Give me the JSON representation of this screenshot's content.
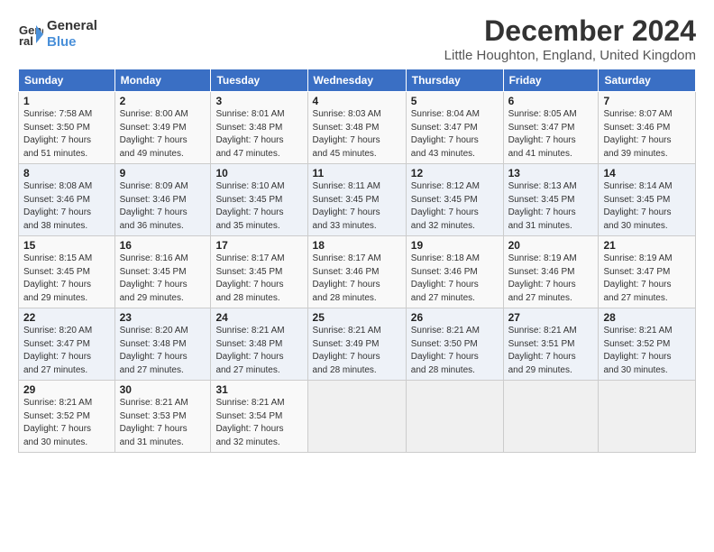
{
  "logo": {
    "line1": "General",
    "line2": "Blue"
  },
  "title": "December 2024",
  "subtitle": "Little Houghton, England, United Kingdom",
  "days_of_week": [
    "Sunday",
    "Monday",
    "Tuesday",
    "Wednesday",
    "Thursday",
    "Friday",
    "Saturday"
  ],
  "weeks": [
    [
      {
        "day": "1",
        "info": "Sunrise: 7:58 AM\nSunset: 3:50 PM\nDaylight: 7 hours\nand 51 minutes."
      },
      {
        "day": "2",
        "info": "Sunrise: 8:00 AM\nSunset: 3:49 PM\nDaylight: 7 hours\nand 49 minutes."
      },
      {
        "day": "3",
        "info": "Sunrise: 8:01 AM\nSunset: 3:48 PM\nDaylight: 7 hours\nand 47 minutes."
      },
      {
        "day": "4",
        "info": "Sunrise: 8:03 AM\nSunset: 3:48 PM\nDaylight: 7 hours\nand 45 minutes."
      },
      {
        "day": "5",
        "info": "Sunrise: 8:04 AM\nSunset: 3:47 PM\nDaylight: 7 hours\nand 43 minutes."
      },
      {
        "day": "6",
        "info": "Sunrise: 8:05 AM\nSunset: 3:47 PM\nDaylight: 7 hours\nand 41 minutes."
      },
      {
        "day": "7",
        "info": "Sunrise: 8:07 AM\nSunset: 3:46 PM\nDaylight: 7 hours\nand 39 minutes."
      }
    ],
    [
      {
        "day": "8",
        "info": "Sunrise: 8:08 AM\nSunset: 3:46 PM\nDaylight: 7 hours\nand 38 minutes."
      },
      {
        "day": "9",
        "info": "Sunrise: 8:09 AM\nSunset: 3:46 PM\nDaylight: 7 hours\nand 36 minutes."
      },
      {
        "day": "10",
        "info": "Sunrise: 8:10 AM\nSunset: 3:45 PM\nDaylight: 7 hours\nand 35 minutes."
      },
      {
        "day": "11",
        "info": "Sunrise: 8:11 AM\nSunset: 3:45 PM\nDaylight: 7 hours\nand 33 minutes."
      },
      {
        "day": "12",
        "info": "Sunrise: 8:12 AM\nSunset: 3:45 PM\nDaylight: 7 hours\nand 32 minutes."
      },
      {
        "day": "13",
        "info": "Sunrise: 8:13 AM\nSunset: 3:45 PM\nDaylight: 7 hours\nand 31 minutes."
      },
      {
        "day": "14",
        "info": "Sunrise: 8:14 AM\nSunset: 3:45 PM\nDaylight: 7 hours\nand 30 minutes."
      }
    ],
    [
      {
        "day": "15",
        "info": "Sunrise: 8:15 AM\nSunset: 3:45 PM\nDaylight: 7 hours\nand 29 minutes."
      },
      {
        "day": "16",
        "info": "Sunrise: 8:16 AM\nSunset: 3:45 PM\nDaylight: 7 hours\nand 29 minutes."
      },
      {
        "day": "17",
        "info": "Sunrise: 8:17 AM\nSunset: 3:45 PM\nDaylight: 7 hours\nand 28 minutes."
      },
      {
        "day": "18",
        "info": "Sunrise: 8:17 AM\nSunset: 3:46 PM\nDaylight: 7 hours\nand 28 minutes."
      },
      {
        "day": "19",
        "info": "Sunrise: 8:18 AM\nSunset: 3:46 PM\nDaylight: 7 hours\nand 27 minutes."
      },
      {
        "day": "20",
        "info": "Sunrise: 8:19 AM\nSunset: 3:46 PM\nDaylight: 7 hours\nand 27 minutes."
      },
      {
        "day": "21",
        "info": "Sunrise: 8:19 AM\nSunset: 3:47 PM\nDaylight: 7 hours\nand 27 minutes."
      }
    ],
    [
      {
        "day": "22",
        "info": "Sunrise: 8:20 AM\nSunset: 3:47 PM\nDaylight: 7 hours\nand 27 minutes."
      },
      {
        "day": "23",
        "info": "Sunrise: 8:20 AM\nSunset: 3:48 PM\nDaylight: 7 hours\nand 27 minutes."
      },
      {
        "day": "24",
        "info": "Sunrise: 8:21 AM\nSunset: 3:48 PM\nDaylight: 7 hours\nand 27 minutes."
      },
      {
        "day": "25",
        "info": "Sunrise: 8:21 AM\nSunset: 3:49 PM\nDaylight: 7 hours\nand 28 minutes."
      },
      {
        "day": "26",
        "info": "Sunrise: 8:21 AM\nSunset: 3:50 PM\nDaylight: 7 hours\nand 28 minutes."
      },
      {
        "day": "27",
        "info": "Sunrise: 8:21 AM\nSunset: 3:51 PM\nDaylight: 7 hours\nand 29 minutes."
      },
      {
        "day": "28",
        "info": "Sunrise: 8:21 AM\nSunset: 3:52 PM\nDaylight: 7 hours\nand 30 minutes."
      }
    ],
    [
      {
        "day": "29",
        "info": "Sunrise: 8:21 AM\nSunset: 3:52 PM\nDaylight: 7 hours\nand 30 minutes."
      },
      {
        "day": "30",
        "info": "Sunrise: 8:21 AM\nSunset: 3:53 PM\nDaylight: 7 hours\nand 31 minutes."
      },
      {
        "day": "31",
        "info": "Sunrise: 8:21 AM\nSunset: 3:54 PM\nDaylight: 7 hours\nand 32 minutes."
      },
      {
        "day": "",
        "info": ""
      },
      {
        "day": "",
        "info": ""
      },
      {
        "day": "",
        "info": ""
      },
      {
        "day": "",
        "info": ""
      }
    ]
  ]
}
